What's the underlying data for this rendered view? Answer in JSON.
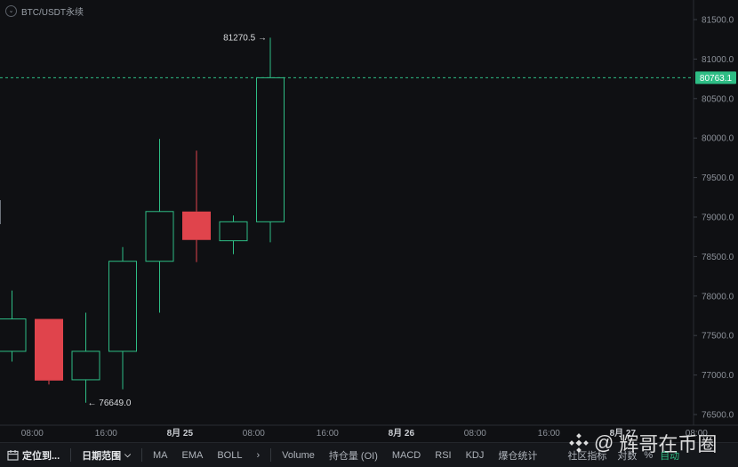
{
  "symbol": {
    "name": "BTC/USDT永续"
  },
  "chart_data": {
    "type": "candlestick",
    "y_ticks": [
      "81500.0",
      "81000.0",
      "80500.0",
      "80000.0",
      "79500.0",
      "79000.0",
      "78500.0",
      "78000.0",
      "77500.0",
      "77000.0",
      "76500.0"
    ],
    "ylim": [
      76400,
      81620
    ],
    "x_labels": [
      {
        "label": "08:00",
        "i": 0.55
      },
      {
        "label": "16:00",
        "i": 2.55
      },
      {
        "label": "8月 25",
        "i": 4.55
      },
      {
        "label": "08:00",
        "i": 6.55
      },
      {
        "label": "16:00",
        "i": 8.55
      },
      {
        "label": "8月 26",
        "i": 10.55
      },
      {
        "label": "08:00",
        "i": 12.55
      },
      {
        "label": "16:00",
        "i": 14.55
      },
      {
        "label": "8月 27",
        "i": 16.55
      },
      {
        "label": "08:00",
        "i": 18.55
      }
    ],
    "candles": [
      {
        "o": 77300,
        "h": 78070,
        "l": 77170,
        "c": 77710
      },
      {
        "o": 77710,
        "h": 77710,
        "l": 76880,
        "c": 76930
      },
      {
        "o": 76940,
        "h": 77790,
        "l": 76649,
        "c": 77300
      },
      {
        "o": 77300,
        "h": 78620,
        "l": 76820,
        "c": 78440
      },
      {
        "o": 78440,
        "h": 79990,
        "l": 77790,
        "c": 79070
      },
      {
        "o": 79070,
        "h": 79840,
        "l": 78430,
        "c": 78710
      },
      {
        "o": 78700,
        "h": 79020,
        "l": 78530,
        "c": 78940
      },
      {
        "o": 78940,
        "h": 81270.5,
        "l": 78680,
        "c": 80763.1
      }
    ],
    "high_label": "81270.5 →",
    "low_label": "← 76649.0",
    "last_price": "80763.1",
    "colors": {
      "up": "#2ebd85",
      "down": "#e0444c",
      "grid": "#1d2025",
      "axis_text": "#8b9098"
    }
  },
  "toolbar": {
    "locate": "定位到...",
    "date_range": "日期范围",
    "indicators": [
      "MA",
      "EMA",
      "BOLL"
    ],
    "more": "›",
    "sub_indicators": [
      "Volume",
      "持仓量 (OI)",
      "MACD",
      "RSI",
      "KDJ",
      "爆仓统计"
    ],
    "right_items": [
      "社区指标",
      "对数",
      "%",
      "自动"
    ]
  },
  "watermark": {
    "text": "辉哥在币圈"
  }
}
